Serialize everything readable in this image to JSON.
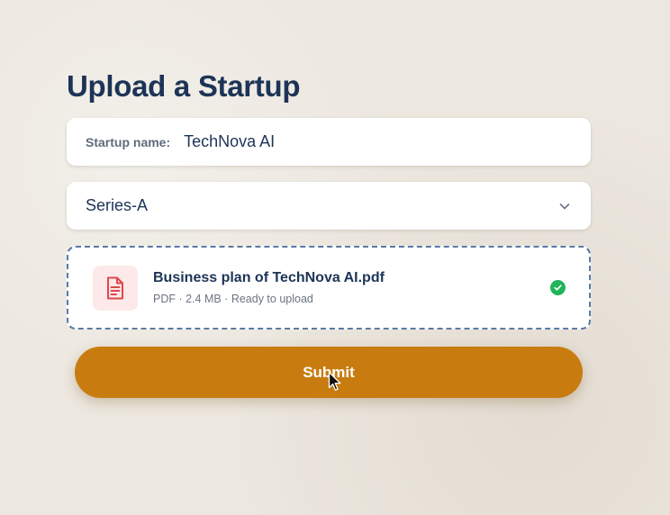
{
  "page": {
    "title": "Upload a Startup"
  },
  "form": {
    "startup_name_label": "Startup name:",
    "startup_name_value": "TechNova AI",
    "stage_select": {
      "selected": "Series-A",
      "icon": "chevron-down-icon"
    },
    "file": {
      "name": "Business plan of TechNova AI.pdf",
      "meta": "PDF · 2.4 MB · Ready to upload",
      "icon": "pdf-file-icon",
      "status_icon": "check-circle-icon",
      "status_color": "#22b45a"
    },
    "submit_label": "Submit"
  },
  "colors": {
    "accent": "#c87c10",
    "title": "#1d3456",
    "dropzone_border": "#5b7aa6",
    "file_icon": "#e0474c",
    "background": "#ece7df"
  }
}
